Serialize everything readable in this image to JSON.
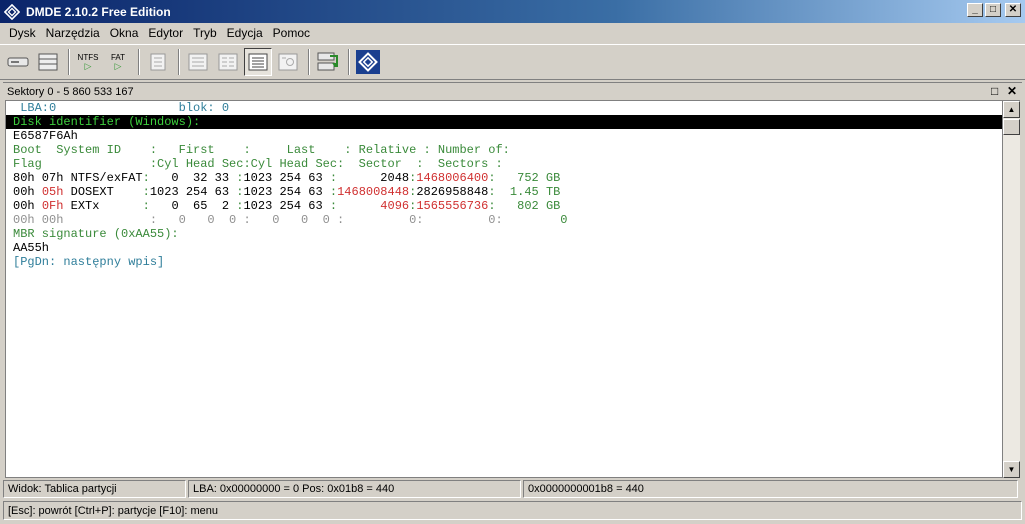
{
  "window": {
    "title": "DMDE 2.10.2 Free Edition"
  },
  "menu": [
    "Dysk",
    "Narzędzia",
    "Okna",
    "Edytor",
    "Tryb",
    "Edycja",
    "Pomoc"
  ],
  "toolbar": {
    "ntfs_label": "NTFS",
    "fat_label": "FAT"
  },
  "panel": {
    "title": "Sektory 0 - 5 860 533 167"
  },
  "editor": {
    "lines": [
      {
        "segs": [
          [
            "t",
            " LBA:0                 blok: 0"
          ]
        ]
      },
      {
        "hl": true,
        "segs": [
          [
            "",
            "Disk identifier (Windows):"
          ]
        ]
      },
      {
        "segs": [
          [
            "",
            "E6587F6Ah"
          ]
        ]
      },
      {
        "segs": [
          [
            "g",
            "Boot  System ID    :   First    :     Last    : Relative : Number of:"
          ]
        ]
      },
      {
        "segs": [
          [
            "g",
            "Flag               :Cyl Head Sec:Cyl Head Sec:  Sector  :  Sectors :"
          ]
        ]
      },
      {
        "segs": [
          [
            "",
            "80h 07h NTFS/exFAT"
          ],
          [
            "g",
            ":"
          ],
          [
            "",
            "   0  32 33 "
          ],
          [
            "g",
            ":"
          ],
          [
            "",
            "1023 254 63 "
          ],
          [
            "g",
            ":"
          ],
          [
            "",
            "      2048"
          ],
          [
            "g",
            ":"
          ],
          [
            "r",
            "1468006400"
          ],
          [
            "g",
            ":"
          ],
          [
            "g",
            "   752 GB"
          ]
        ]
      },
      {
        "segs": [
          [
            "",
            "00h "
          ],
          [
            "r",
            "05h"
          ],
          [
            "",
            " DOSEXT    "
          ],
          [
            "g",
            ":"
          ],
          [
            "",
            "1023 254 63 "
          ],
          [
            "g",
            ":"
          ],
          [
            "",
            "1023 254 63 "
          ],
          [
            "g",
            ":"
          ],
          [
            "r",
            "1468008448"
          ],
          [
            "g",
            ":"
          ],
          [
            "",
            "2826958848"
          ],
          [
            "g",
            ":"
          ],
          [
            "g",
            "  1.45 TB"
          ]
        ]
      },
      {
        "segs": [
          [
            "",
            "00h "
          ],
          [
            "r",
            "0Fh"
          ],
          [
            "",
            " EXTx      "
          ],
          [
            "g",
            ":"
          ],
          [
            "",
            "   0  65  2 "
          ],
          [
            "g",
            ":"
          ],
          [
            "",
            "1023 254 63 "
          ],
          [
            "g",
            ":"
          ],
          [
            "r",
            "      4096"
          ],
          [
            "g",
            ":"
          ],
          [
            "r",
            "1565556736"
          ],
          [
            "g",
            ":"
          ],
          [
            "g",
            "   802 GB"
          ]
        ]
      },
      {
        "segs": [
          [
            "gr",
            "00h 00h            :   0   0  0 :   0   0  0 :         0:         0:"
          ],
          [
            "g",
            "        0"
          ]
        ]
      },
      {
        "segs": [
          [
            "g",
            "MBR signature (0xAA55):"
          ]
        ]
      },
      {
        "segs": [
          [
            "",
            "AA55h"
          ]
        ]
      },
      {
        "segs": [
          [
            "t",
            "[PgDn: następny wpis]"
          ]
        ]
      }
    ]
  },
  "status": {
    "view": "Widok: Tablica partycji",
    "lba": "LBA: 0x00000000 = 0  Pos: 0x01b8 = 440",
    "offset": "0x0000000001b8 = 440"
  },
  "hint": "[Esc]: powrót  [Ctrl+P]: partycje  [F10]: menu",
  "colors": {
    "green": "#3a8a3a",
    "teal": "#2f7e9a",
    "red": "#d03030",
    "highlight_bg": "#000000"
  }
}
